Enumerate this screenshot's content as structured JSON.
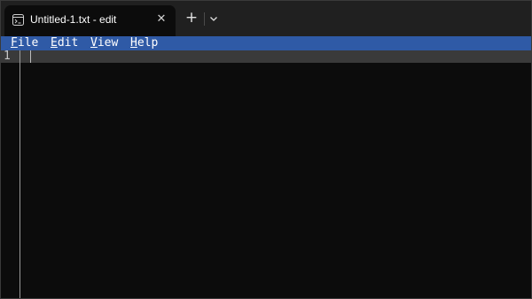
{
  "tab": {
    "title": "Untitled-1.txt - edit",
    "icon": "terminal-app-icon"
  },
  "tabbar": {
    "close_glyph": "✕",
    "new_tab_glyph": "+",
    "dropdown_icon": "chevron-down-icon"
  },
  "menu": {
    "items": [
      {
        "accel": "F",
        "rest": "ile"
      },
      {
        "accel": "E",
        "rest": "dit"
      },
      {
        "accel": "V",
        "rest": "iew"
      },
      {
        "accel": "H",
        "rest": "elp"
      }
    ]
  },
  "editor": {
    "line_numbers": [
      "1"
    ],
    "content": ""
  },
  "colors": {
    "menubar": "#2f5aa6",
    "tabbar": "#202020",
    "editor_bg": "#0c0c0c",
    "current_line": "#3a3a3a"
  }
}
